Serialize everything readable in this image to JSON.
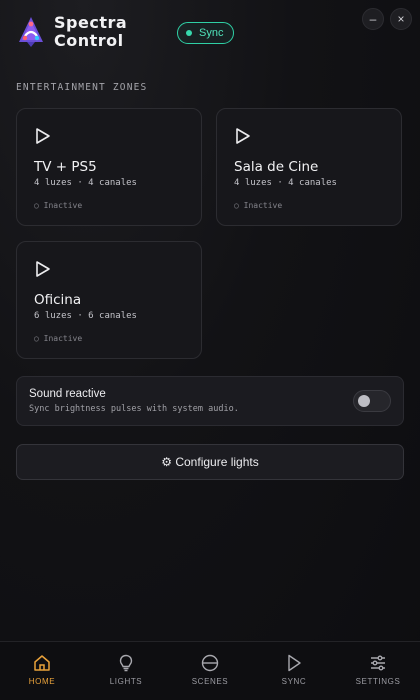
{
  "app": {
    "title_line1": "Spectra",
    "title_line2": "Control",
    "sync_label": "Sync",
    "minimize_label": "–",
    "close_label": "×",
    "accent": "#e9a23b",
    "sync_color": "#2fd0a5"
  },
  "section": {
    "title": "ENTERTAINMENT ZONES"
  },
  "zones": [
    {
      "name": "TV + PS5",
      "meta": "4 luzes · 4 canales",
      "status": "○ Inactive"
    },
    {
      "name": "Sala de Cine",
      "meta": "4 luzes · 4 canales",
      "status": "○ Inactive"
    },
    {
      "name": "Oficina",
      "meta": "6 luzes · 6 canales",
      "status": "○ Inactive"
    }
  ],
  "sound_reactive": {
    "title": "Sound reactive",
    "description": "Sync brightness pulses with system audio.",
    "enabled": false
  },
  "configure": {
    "icon": "gear-icon",
    "label": "⚙ Configure lights"
  },
  "nav": [
    {
      "label": "HOME",
      "icon": "home-icon",
      "active": true
    },
    {
      "label": "LIGHTS",
      "icon": "bulb-icon",
      "active": false
    },
    {
      "label": "SCENES",
      "icon": "scenes-icon",
      "active": false
    },
    {
      "label": "SYNC",
      "icon": "play-icon",
      "active": false
    },
    {
      "label": "SETTINGS",
      "icon": "sliders-icon",
      "active": false
    }
  ]
}
